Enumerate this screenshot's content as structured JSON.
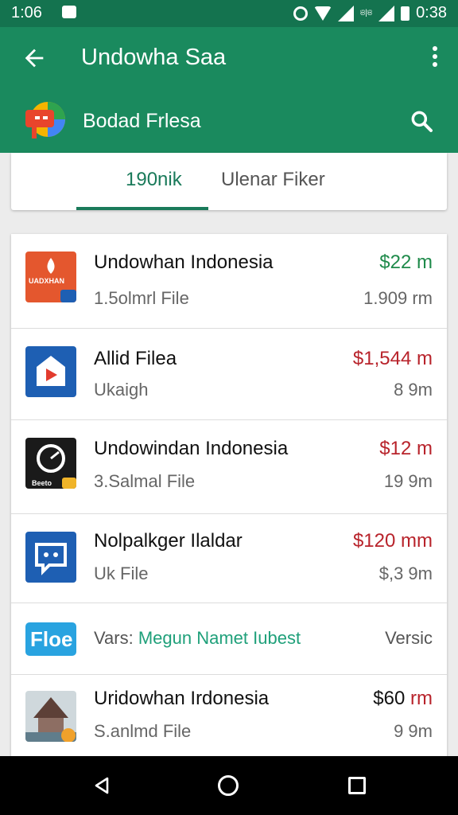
{
  "status_bar": {
    "time_left": "1:06",
    "time_right": "0:38",
    "tiny_text": "ଞ|ଞ"
  },
  "header": {
    "title": "Undowha Saa",
    "subtitle": "Bodad Frlesa"
  },
  "tabs": [
    {
      "label": "190nik",
      "active": true
    },
    {
      "label": "Ulenar Fiker",
      "active": false
    }
  ],
  "colors": {
    "primary": "#1a8a5e",
    "status_bar": "#14734f",
    "accent": "#1a7a5a",
    "price_green": "#1e8a4a",
    "price_red": "#b8232b"
  },
  "list": {
    "items": [
      {
        "title": "Undowhan Indonesia",
        "subtitle": "1.5olmrl File",
        "price": "$22 m",
        "price_color": "#1e8a4a",
        "size": "1.909 rm",
        "thumb_label": "UADXHAN",
        "icon": "red-app-icon"
      },
      {
        "title": "Allid Filea",
        "subtitle": "Ukaigh",
        "price": "$1,544 m",
        "price_color": "#b8232b",
        "size": "8 9m",
        "icon": "play-app-icon"
      },
      {
        "title": "Undowindan Indonesia",
        "subtitle": "3.Salmal File",
        "price": "$12 m",
        "price_color": "#b8232b",
        "size": "19 9m",
        "thumb_label": "Beeto",
        "icon": "camera-app-icon"
      },
      {
        "title": "Nolpalkger Ilaldar",
        "subtitle": "Uk File",
        "price": "$120 mm",
        "price_color": "#b8232b",
        "size": "$,3 9m",
        "icon": "chat-app-icon"
      },
      {
        "tag_prefix": "Vars:",
        "tag_highlight": "Megun Namet Iubest",
        "version": "Versic",
        "thumb_label": "Floe",
        "icon": "floe-app-icon"
      },
      {
        "title": "Uridowhan Irdonesia",
        "subtitle": "S.anlmd File",
        "price_dollar": "$60",
        "price_unit": "rm",
        "price_color": "#b8232b",
        "size": "9 9m",
        "icon": "temple-app-icon"
      }
    ]
  }
}
